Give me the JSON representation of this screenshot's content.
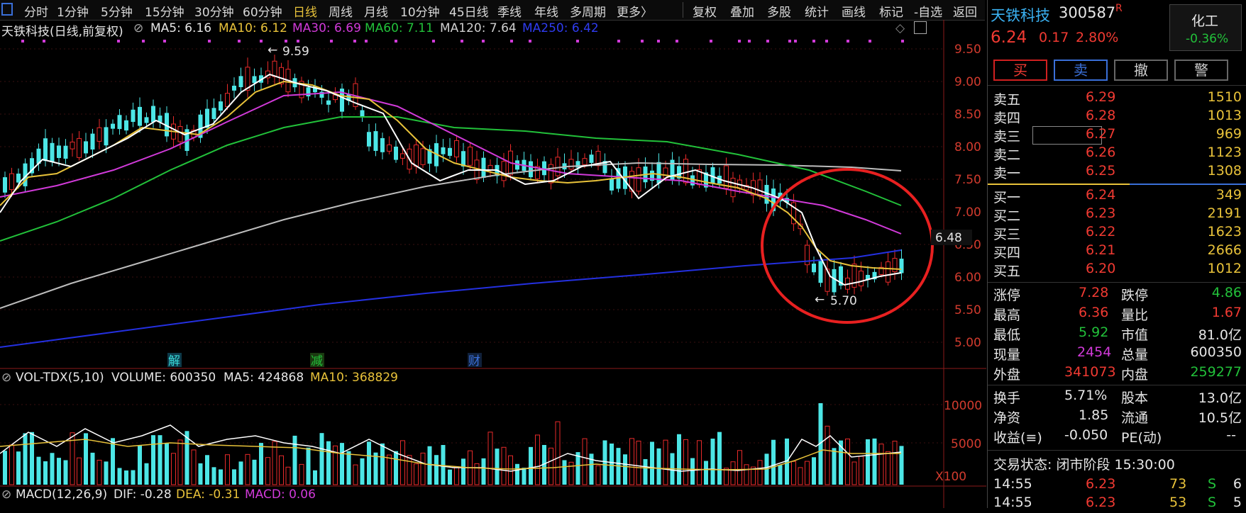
{
  "toolbar": {
    "periods": [
      "分时",
      "1分钟",
      "5分钟",
      "15分钟",
      "30分钟",
      "60分钟",
      "日线",
      "周线",
      "月线",
      "10分钟",
      "45日线",
      "季线",
      "年线",
      "多周期",
      "更多〉"
    ],
    "active_period": "日线",
    "tools": [
      "复权",
      "叠加",
      "多股",
      "统计",
      "画线",
      "标记",
      "-自选",
      "返回"
    ]
  },
  "chart_header": {
    "title": "天铁科技(日线,前复权)",
    "ma5": "MA5: 6.16",
    "ma10": "MA10: 6.12",
    "ma30": "MA30: 6.69",
    "ma60": "MA60: 7.11",
    "ma120": "MA120: 7.64",
    "ma250": "MA250: 6.42",
    "colors": {
      "ma5": "#ffffff",
      "ma10": "#e8c23a",
      "ma30": "#d13ad9",
      "ma60": "#22c13a",
      "ma120": "#bdbdbd",
      "ma250": "#2430e0"
    }
  },
  "chart_annotations": {
    "high_label": "9.59",
    "low_label": "5.70",
    "current_price_tag": "6.48",
    "event_markers": [
      "解",
      "减",
      "财"
    ]
  },
  "price_axis": [
    "9.50",
    "9.00",
    "8.50",
    "8.00",
    "7.50",
    "7.00",
    "6.50",
    "6.00",
    "5.50",
    "5.00"
  ],
  "volume_header": {
    "label": "VOL-TDX(5,10)",
    "volume": "VOLUME: 600350",
    "ma5": "MA5: 424868",
    "ma10": "MA10: 368829"
  },
  "volume_axis": [
    "10000",
    "5000",
    "X100"
  ],
  "macd_header": {
    "label": "MACD(12,26,9)",
    "dif": "DIF: -0.28",
    "dea": "DEA: -0.31",
    "macd": "MACD: 0.06"
  },
  "stock": {
    "name": "天铁科技",
    "code": "300587",
    "tag": "R",
    "price": "6.24",
    "change": "0.17",
    "change_pct": "2.80%",
    "sector": "化工",
    "sector_pct": "-0.36%"
  },
  "trade_buttons": {
    "buy": "买",
    "sell": "卖",
    "cancel": "撤",
    "alert": "警"
  },
  "order_book": {
    "asks": [
      {
        "label": "卖五",
        "price": "6.29",
        "vol": "1510"
      },
      {
        "label": "卖四",
        "price": "6.28",
        "vol": "1013"
      },
      {
        "label": "卖三",
        "price": "6.27",
        "vol": "969"
      },
      {
        "label": "卖二",
        "price": "6.26",
        "vol": "1123"
      },
      {
        "label": "卖一",
        "price": "6.25",
        "vol": "1308"
      }
    ],
    "bids": [
      {
        "label": "买一",
        "price": "6.24",
        "vol": "349"
      },
      {
        "label": "买二",
        "price": "6.23",
        "vol": "2191"
      },
      {
        "label": "买三",
        "price": "6.22",
        "vol": "1623"
      },
      {
        "label": "买四",
        "price": "6.21",
        "vol": "2666"
      },
      {
        "label": "买五",
        "price": "6.20",
        "vol": "1012"
      }
    ]
  },
  "stats": {
    "limit_up_label": "涨停",
    "limit_up": "7.28",
    "limit_down_label": "跌停",
    "limit_down": "4.86",
    "high_label": "最高",
    "high": "6.36",
    "vol_ratio_label": "量比",
    "vol_ratio": "1.67",
    "low_label": "最低",
    "low": "5.92",
    "mktcap_label": "市值",
    "mktcap": "81.0亿",
    "cur_vol_label": "现量",
    "cur_vol": "2454",
    "total_vol_label": "总量",
    "total_vol": "600350",
    "outer_label": "外盘",
    "outer": "341073",
    "inner_label": "内盘",
    "inner": "259277",
    "turnover_label": "换手",
    "turnover": "5.71%",
    "equity_label": "股本",
    "equity": "13.0亿",
    "nav_label": "净资",
    "nav": "1.85",
    "float_label": "流通",
    "float": "10.5亿",
    "eps_label": "收益(≡)",
    "eps": "-0.050",
    "pe_label": "PE(动)",
    "pe": "--"
  },
  "trade_status": "交易状态: 闭市阶段 15:30:00",
  "ticks": [
    {
      "time": "14:55",
      "price": "6.23",
      "vol": "73",
      "side": "S",
      "n": "6"
    },
    {
      "time": "14:55",
      "price": "6.23",
      "vol": "53",
      "side": "S",
      "n": "5"
    }
  ]
}
